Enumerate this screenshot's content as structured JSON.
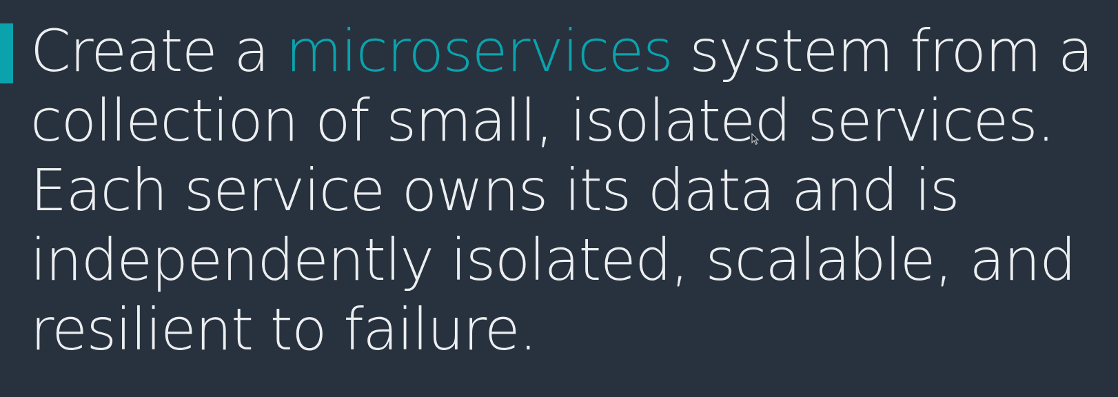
{
  "slide": {
    "accent_color": "#0aa3ad",
    "text_color": "#eceef0",
    "background_color": "#28323f",
    "statement": {
      "line1_before": "Create a ",
      "line1_highlight": "microservices",
      "line1_after": " system from a",
      "line2": "collection of small, isolated services.",
      "line3": "Each service owns its data and is",
      "line4": "independently isolated, scalable, and",
      "line5": "resilient to failure."
    }
  },
  "cursor": {
    "icon": "mouse-pointer-icon"
  }
}
